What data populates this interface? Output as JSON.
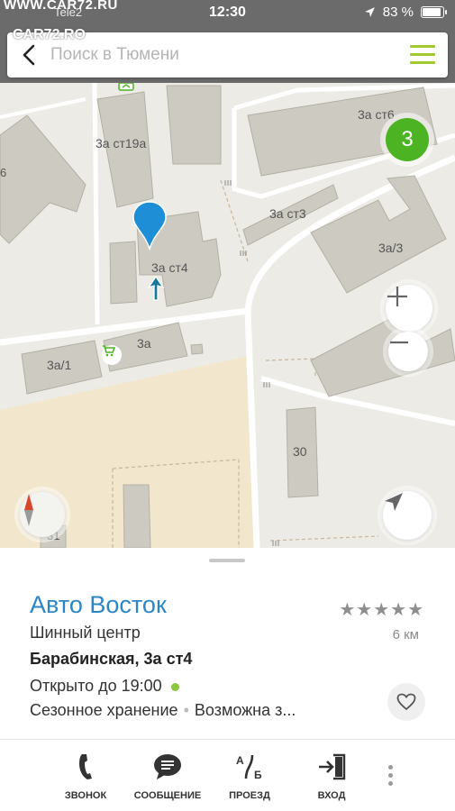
{
  "status_bar": {
    "carrier": "Tele2",
    "time": "12:30",
    "battery": "83 %",
    "battery_level": 0.83,
    "watermark_top": "WWW.CAR72.RU",
    "watermark_logo": "CAR72.RO"
  },
  "search": {
    "placeholder": "Поиск в Тюмени"
  },
  "map": {
    "cluster_count": "3",
    "labels": {
      "st19a": "3а ст19а",
      "st6": "3а ст6",
      "st3": "3а ст3",
      "a3": "3а/3",
      "st4": "3а ст4",
      "a": "3а",
      "a1": "3а/1",
      "n30": "30",
      "n31": "31",
      "n6": "6"
    },
    "icons": [
      "back-icon",
      "menu-icon",
      "place-marker-icon",
      "location-arrow-icon",
      "shopping-cart-icon",
      "zoom-in-icon",
      "zoom-out-icon",
      "compass-icon",
      "my-location-icon"
    ]
  },
  "place": {
    "name": "Авто Восток",
    "rating_stars": "★★★★★",
    "distance": "6 км",
    "category": "Шинный центр",
    "address": "Барабинская, 3а ст4",
    "hours": "Открыто до 19:00",
    "tag1": "Сезонное хранение",
    "tag_sep": "•",
    "tag2": "Возможна з..."
  },
  "tabs": [
    {
      "label": "ЗВОНОК"
    },
    {
      "label": "СООБЩЕНИЕ"
    },
    {
      "label": "ПРОЕЗД"
    },
    {
      "label": "ВХОД"
    }
  ],
  "colors": {
    "accent_green": "#9fc92d",
    "badge_green": "#4cb322",
    "title_blue": "#2b86c5",
    "marker_blue": "#1e8fd6"
  }
}
